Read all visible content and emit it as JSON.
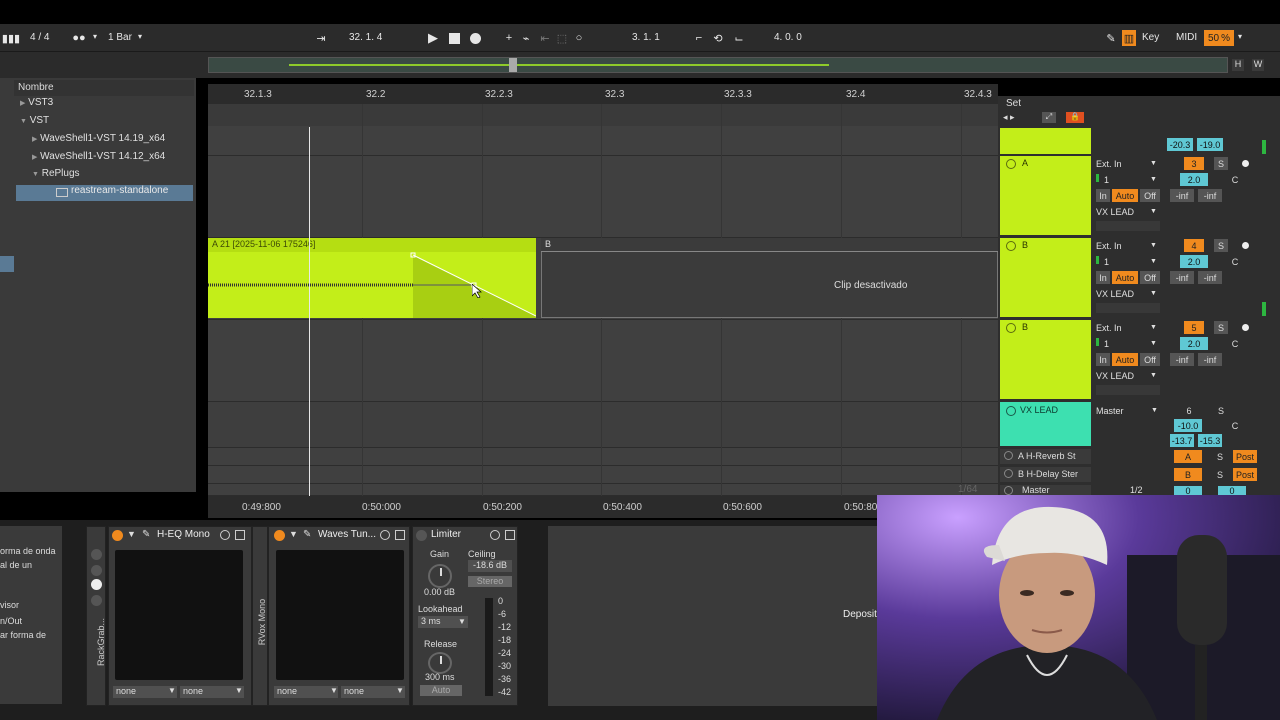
{
  "transport": {
    "time_sig": "4 / 4",
    "quantize": "1 Bar",
    "position": "32.  1.  4",
    "loop_start": "3.  1.  1",
    "loop_length": "4.  0.  0",
    "key_label": "Key",
    "midi_label": "MIDI",
    "cpu": "50",
    "cpu_unit": "%"
  },
  "overview": {
    "h_label": "H",
    "w_label": "W"
  },
  "browser": {
    "header": "Nombre",
    "items": [
      {
        "label": "VST3",
        "arrow": "▶"
      },
      {
        "label": "VST",
        "arrow": "▼"
      },
      {
        "label": "WaveShell1-VST 14.19_x64",
        "arrow": "▶"
      },
      {
        "label": "WaveShell1-VST 14.12_x64",
        "arrow": "▶"
      },
      {
        "label": "RePlugs",
        "arrow": "▼"
      },
      {
        "label": "reastream-standalone",
        "arrow": ""
      }
    ]
  },
  "ruler": [
    "32.1.3",
    "32.2",
    "32.2.3",
    "32.3",
    "32.3.3",
    "32.4",
    "32.4.3"
  ],
  "set_label": "Set",
  "clips": {
    "a_title": "A 21 [2025-11-06 175246]",
    "b_title": "B",
    "b_status": "Clip desactivado"
  },
  "timeline": [
    "0:49:800",
    "0:50:000",
    "0:50:200",
    "0:50:400",
    "0:50:600",
    "0:50:80"
  ],
  "mixer": {
    "top_values": [
      "-20.3",
      "-19.0"
    ],
    "tracks": [
      {
        "name": "A",
        "input": "Ext. In",
        "channel": "1",
        "num": "3",
        "solo": "S",
        "vol": "2.0",
        "pan": "C",
        "in": "In",
        "auto": "Auto",
        "off": "Off",
        "inf1": "-inf",
        "inf2": "-inf",
        "out": "VX LEAD"
      },
      {
        "name": "B",
        "input": "Ext. In",
        "channel": "1",
        "num": "4",
        "solo": "S",
        "vol": "2.0",
        "pan": "C",
        "in": "In",
        "auto": "Auto",
        "off": "Off",
        "inf1": "-inf",
        "inf2": "-inf",
        "out": "VX LEAD"
      },
      {
        "name": "B",
        "input": "Ext. In",
        "channel": "1",
        "num": "5",
        "solo": "S",
        "vol": "2.0",
        "pan": "C",
        "in": "In",
        "auto": "Auto",
        "off": "Off",
        "inf1": "-inf",
        "inf2": "-inf",
        "out": "VX LEAD"
      }
    ],
    "group": {
      "name": "VX LEAD",
      "out": "Master",
      "num": "6",
      "solo": "S",
      "vol": "-10.0",
      "pan": "C",
      "m1": "-13.7",
      "m2": "-15.3"
    },
    "returns": [
      {
        "name": "A H-Reverb St",
        "letter": "A",
        "solo": "S",
        "post": "Post"
      },
      {
        "name": "B H-Delay Ster",
        "letter": "B",
        "solo": "S",
        "post": "Post"
      }
    ],
    "master": {
      "name": "Master",
      "ratio": "1/2",
      "v1": "0",
      "v2": "0",
      "zoom": "1/64"
    }
  },
  "left_info": [
    "orma de onda",
    "al de un",
    "visor",
    "n/Out",
    "ar forma de"
  ],
  "devices": {
    "rack_label": "RackGrab...",
    "hq": {
      "title": "H-EQ Mono",
      "sel1": "none",
      "sel2": "none"
    },
    "rvox_label": "RVox Mono",
    "tune": {
      "title": "Waves Tun...",
      "sel1": "none",
      "sel2": "none"
    },
    "limiter": {
      "title": "Limiter",
      "gain_label": "Gain",
      "gain_value": "0.00 dB",
      "ceiling_label": "Ceiling",
      "ceiling_value": "-18.6 dB",
      "stereo": "Stereo",
      "lookahead_label": "Lookahead",
      "lookahead_value": "3 ms",
      "release_label": "Release",
      "release_value": "300 ms",
      "auto": "Auto",
      "scale": [
        "0",
        "-6",
        "-12",
        "-18",
        "-24",
        "-30",
        "-36",
        "-42"
      ]
    },
    "drop_text": "Deposit"
  },
  "colors": {
    "clip": "#c3ee19",
    "group": "#3de0b0",
    "orange": "#f08a1e",
    "cyan": "#5fc8d4"
  }
}
